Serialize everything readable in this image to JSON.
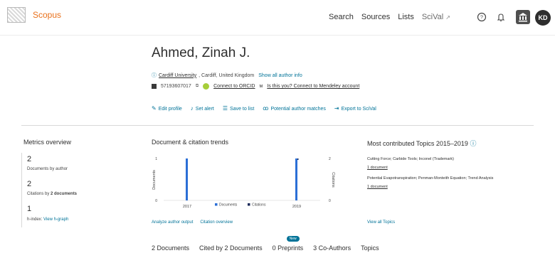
{
  "header": {
    "logo_text": "Scopus",
    "nav": [
      "Search",
      "Sources",
      "Lists"
    ],
    "scival_label": "SciVal",
    "scival_icon": "external-link-icon",
    "avatar_initials": "KD"
  },
  "author": {
    "name": "Ahmed, Zinah J.",
    "affiliation_link": "Cardiff University",
    "affiliation_rest": ", Cardiff, United Kingdom",
    "show_all_info": "Show all author info",
    "scopus_id": "57193607017",
    "orcid_link": "Connect to ORCID",
    "mendeley_text": "Is this you? Connect to Mendeley account"
  },
  "actions": [
    {
      "label": "Edit profile",
      "icon": "pencil-icon"
    },
    {
      "label": "Set alert",
      "icon": "bell-icon"
    },
    {
      "label": "Save to list",
      "icon": "list-icon"
    },
    {
      "label": "Potential author matches",
      "icon": "people-icon"
    },
    {
      "label": "Export to SciVal",
      "icon": "export-icon"
    }
  ],
  "metrics": {
    "title": "Metrics overview",
    "documents_count": "2",
    "documents_label": "Documents by author",
    "citations_count": "2",
    "citations_label_prefix": "Citations by ",
    "citations_label_bold": "2 documents",
    "hindex_count": "1",
    "hindex_label": "h-index:",
    "hindex_link": "View h-graph"
  },
  "trends": {
    "title": "Document & citation trends",
    "analyze_link": "Analyze author output",
    "citation_overview_link": "Citation overview"
  },
  "chart_data": {
    "type": "bar",
    "categories": [
      "2017",
      "2019"
    ],
    "series": [
      {
        "name": "Documents",
        "values": [
          1,
          1
        ]
      },
      {
        "name": "Citations",
        "values": [
          0,
          2
        ]
      }
    ],
    "xlabel": "",
    "ylabel": "Documents",
    "y2label": "Citations",
    "ylim": [
      0,
      1
    ],
    "y2lim": [
      0,
      2
    ],
    "y_ticks": [
      "0",
      "1"
    ],
    "y2_ticks": [
      "0",
      "2"
    ],
    "colors": {
      "Documents": "#2b6fd6",
      "Citations": "#1c2b5a"
    },
    "legend_position": "bottom"
  },
  "topics": {
    "title": "Most contributed Topics 2015–2019",
    "items": [
      {
        "name": "Cutting Force; Carbide Tools; Inconel (Trademark)",
        "docs": "1 document"
      },
      {
        "name": "Potential Evapotranspiration; Penman-Monteith Equation; Trend Analysis",
        "docs": "1 document"
      }
    ],
    "view_all": "View all Topics"
  },
  "tabs": [
    {
      "label": "2 Documents"
    },
    {
      "label": "Cited by 2 Documents"
    },
    {
      "label": "0 Preprints",
      "badge": "New"
    },
    {
      "label": "3 Co-Authors"
    },
    {
      "label": "Topics"
    }
  ]
}
